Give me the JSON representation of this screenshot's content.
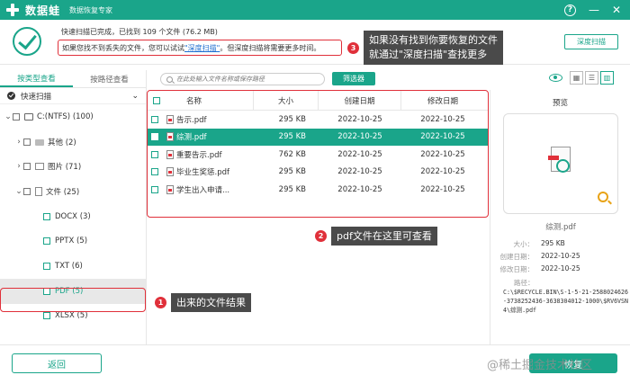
{
  "titlebar": {
    "app_name": "数据蛙",
    "app_sub": "数据恢复专家",
    "help": "?",
    "minimize": "—",
    "close": "✕"
  },
  "header": {
    "status": "快速扫描已完成，已找到 109 个文件 (76.2 MB)",
    "hint_prefix": "如果您找不到丢失的文件，您可以试试",
    "hint_link": "\"深度扫描\"",
    "hint_suffix": "。但深度扫描将需要更多时间。",
    "deep_scan_btn": "深度扫描"
  },
  "annotations": [
    {
      "num": "1",
      "text": "出来的文件结果"
    },
    {
      "num": "2",
      "text": "pdf文件在这里可查看"
    },
    {
      "num": "3",
      "line1": "如果没有找到你要恢复的文件",
      "line2": "就通过\"深度扫描\"查找更多"
    }
  ],
  "sidebar": {
    "tabs": [
      "按类型查看",
      "按路径查看"
    ],
    "scan_mode": "快速扫描",
    "tree": [
      {
        "label": "C:(NTFS) (100)"
      },
      {
        "label": "其他 (2)"
      },
      {
        "label": "图片 (71)"
      },
      {
        "label": "文件 (25)"
      },
      {
        "label": "DOCX (3)"
      },
      {
        "label": "PPTX (5)"
      },
      {
        "label": "TXT (6)"
      },
      {
        "label": "PDF (5)"
      },
      {
        "label": "XLSX (5)"
      }
    ]
  },
  "toolbar": {
    "search_placeholder": "在此处输入文件名称或保存路径",
    "filter_btn": "筛选器"
  },
  "table": {
    "headers": [
      "名称",
      "大小",
      "创建日期",
      "修改日期"
    ],
    "rows": [
      {
        "name": "告示.pdf",
        "size": "295 KB",
        "created": "2022-10-25",
        "modified": "2022-10-25"
      },
      {
        "name": "综测.pdf",
        "size": "295 KB",
        "created": "2022-10-25",
        "modified": "2022-10-25"
      },
      {
        "name": "重要告示.pdf",
        "size": "762 KB",
        "created": "2022-10-25",
        "modified": "2022-10-25"
      },
      {
        "name": "毕业生奖惩.pdf",
        "size": "295 KB",
        "created": "2022-10-25",
        "modified": "2022-10-25"
      },
      {
        "name": "学生出入申请...",
        "size": "295 KB",
        "created": "2022-10-25",
        "modified": "2022-10-25"
      }
    ]
  },
  "preview": {
    "title": "预览",
    "filename": "综测.pdf",
    "size_k": "大小：",
    "size_v": "295 KB",
    "created_k": "创建日期：",
    "created_v": "2022-10-25",
    "modified_k": "修改日期：",
    "modified_v": "2022-10-25",
    "path_k": "路径：",
    "path_v": "C:\\$RECYCLE.BIN\\S-1-5-21-2588024626-3738252436-3638304012-1000\\$RV6VSN4\\综测.pdf"
  },
  "footer": {
    "back": "返回",
    "recover": "恢复"
  },
  "watermark": "@稀土掘金技术社区",
  "colors": {
    "primary": "#1aa58a",
    "annotation": "#e0303a",
    "link": "#1f6fd1"
  }
}
